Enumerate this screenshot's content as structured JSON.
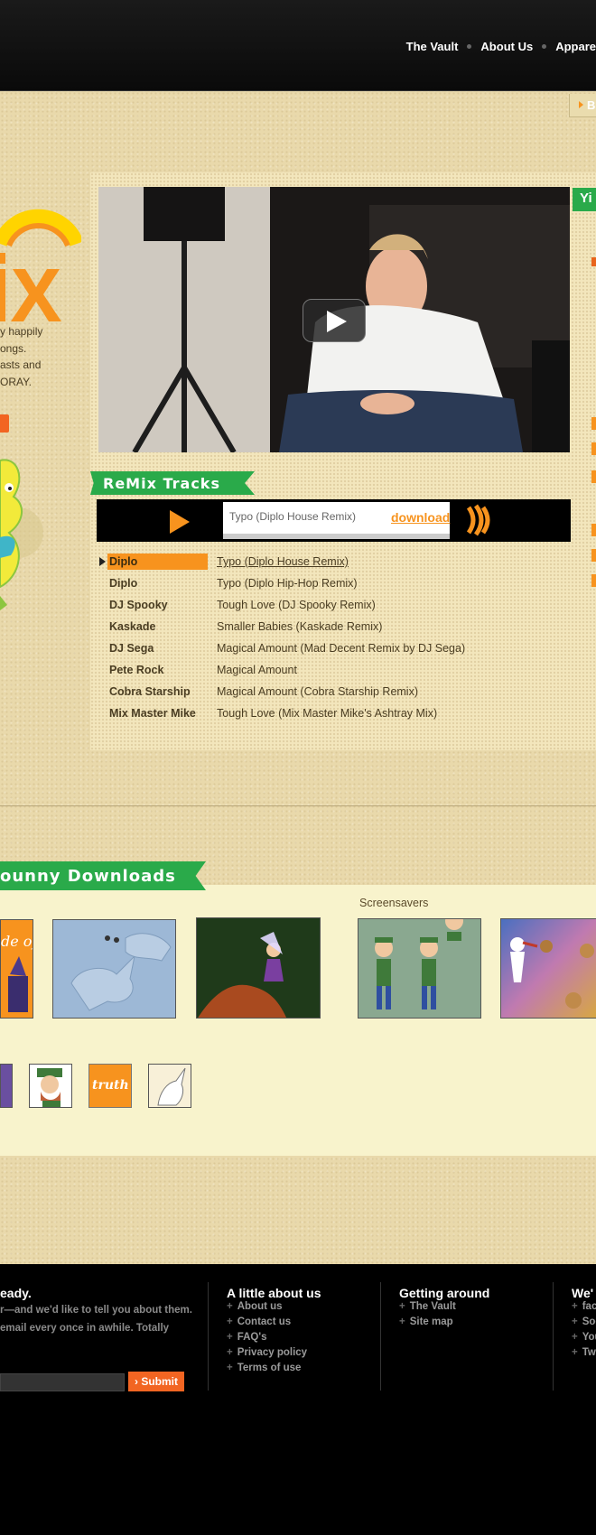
{
  "nav": {
    "items": [
      "The Vault",
      "About Us",
      "Appare"
    ]
  },
  "sub_tab": {
    "label": "B"
  },
  "intro": {
    "lines": [
      "y happily",
      "ongs.",
      "asts and",
      "ORAY."
    ]
  },
  "side_ribbon": {
    "text": "Yi"
  },
  "remix": {
    "ribbon": "ReMix Tracks",
    "now_playing": "Typo (Diplo House Remix)",
    "download_label": "download",
    "tracks": [
      {
        "artist": "Diplo",
        "title": "Typo (Diplo House Remix)"
      },
      {
        "artist": "Diplo",
        "title": "Typo (Diplo Hip-Hop Remix)"
      },
      {
        "artist": "DJ Spooky",
        "title": "Tough Love (DJ Spooky Remix)"
      },
      {
        "artist": "Kaskade",
        "title": "Smaller Babies (Kaskade Remix)"
      },
      {
        "artist": "DJ Sega",
        "title": "Magical Amount (Mad Decent Remix by DJ Sega)"
      },
      {
        "artist": "Pete Rock",
        "title": "Magical Amount"
      },
      {
        "artist": "Cobra Starship",
        "title": "Magical Amount (Cobra Starship Remix)"
      },
      {
        "artist": "Mix Master Mike",
        "title": "Tough Love (Mix Master Mike's Ashtray Mix)"
      }
    ]
  },
  "downloads": {
    "ribbon": "ounny Downloads",
    "screensavers_label": "Screensavers",
    "card_text": "de of",
    "icon_text": "truth"
  },
  "footer": {
    "newsletter_heading": "eady.",
    "newsletter_lines": [
      "r—and we'd like to tell you about them.",
      "email every once in awhile. Totally"
    ],
    "submit_label": "› Submit",
    "about_heading": "A little about us",
    "about_links": [
      "About us",
      "Contact us",
      "FAQ's",
      "Privacy policy",
      "Terms of use"
    ],
    "getting_around_heading": "Getting around",
    "getting_around_links": [
      "The Vault",
      "Site map"
    ],
    "social_heading": "We'",
    "social_links": [
      "fac",
      "Soc",
      "You",
      "Tw"
    ]
  },
  "colors": {
    "accent_orange": "#f7931e",
    "ribbon_green": "#2aaa4a",
    "beige": "#e9d9ab"
  }
}
